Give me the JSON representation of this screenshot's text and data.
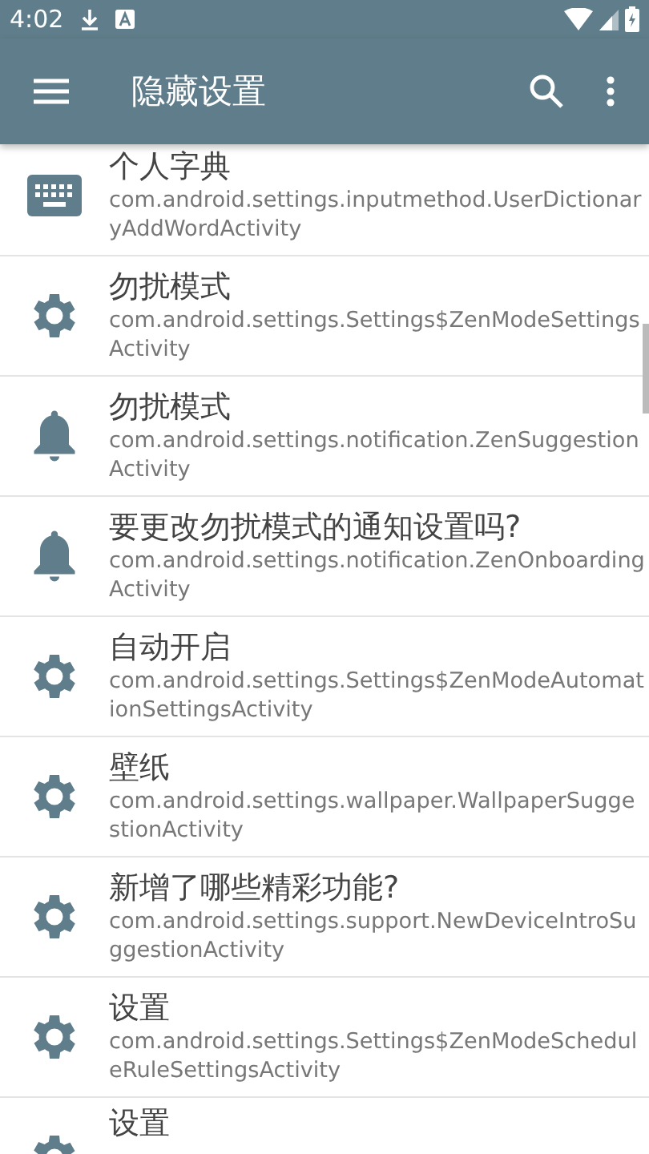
{
  "status_bar": {
    "time": "4:02"
  },
  "toolbar": {
    "title": "隐藏设置"
  },
  "items": [
    {
      "kind": "keyboard",
      "title": "个人字典",
      "subtitle": "com.android.settings.inputmethod.UserDictionaryAddWordActivity"
    },
    {
      "kind": "gear",
      "title": "勿扰模式",
      "subtitle": "com.android.settings.Settings$ZenModeSettingsActivity"
    },
    {
      "kind": "bell",
      "title": "勿扰模式",
      "subtitle": "com.android.settings.notification.ZenSuggestionActivity"
    },
    {
      "kind": "bell",
      "title": "要更改勿扰模式的通知设置吗?",
      "subtitle": "com.android.settings.notification.ZenOnboardingActivity"
    },
    {
      "kind": "gear",
      "title": "自动开启",
      "subtitle": "com.android.settings.Settings$ZenModeAutomationSettingsActivity"
    },
    {
      "kind": "gear",
      "title": "壁纸",
      "subtitle": "com.android.settings.wallpaper.WallpaperSuggestionActivity"
    },
    {
      "kind": "gear",
      "title": "新增了哪些精彩功能?",
      "subtitle": "com.android.settings.support.NewDeviceIntroSuggestionActivity"
    },
    {
      "kind": "gear",
      "title": "设置",
      "subtitle": "com.android.settings.Settings$ZenModeScheduleRuleSettingsActivity"
    },
    {
      "kind": "gear",
      "title": "设置"
    }
  ]
}
